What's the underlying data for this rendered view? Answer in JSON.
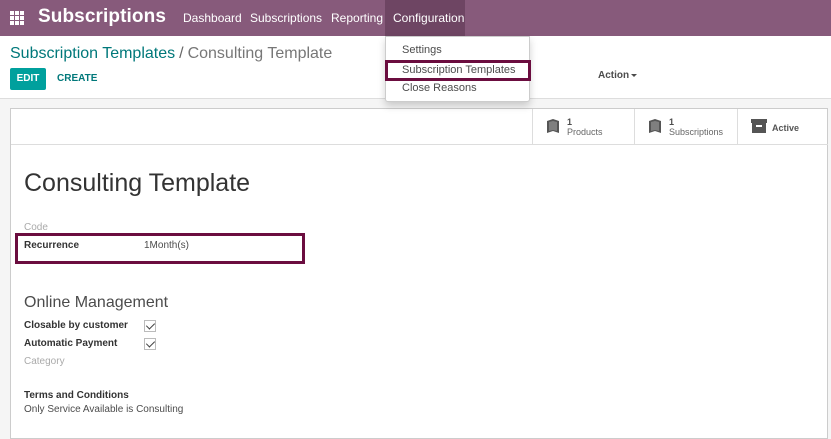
{
  "navbar": {
    "app_name": "Subscriptions",
    "menu": [
      "Dashboard",
      "Subscriptions",
      "Reporting",
      "Configuration"
    ],
    "active": "Configuration",
    "apps_icon": "apps-grid-icon"
  },
  "dropdown": {
    "items": [
      "Settings",
      "Subscription Templates",
      "Close Reasons"
    ],
    "highlighted": "Subscription Templates"
  },
  "breadcrumb": {
    "parent": "Subscription Templates",
    "separator": "/",
    "current": "Consulting Template"
  },
  "buttons": {
    "edit": "EDIT",
    "create": "CREATE",
    "action": "Action"
  },
  "stat_buttons": [
    {
      "icon": "book-icon",
      "value": "1",
      "label": "Products"
    },
    {
      "icon": "book-icon",
      "value": "1",
      "label": "Subscriptions"
    },
    {
      "icon": "archive-icon",
      "value": "",
      "label": "Active"
    }
  ],
  "form": {
    "title": "Consulting Template",
    "code_label": "Code",
    "recurrence_label": "Recurrence",
    "recurrence_value": "1Month(s)",
    "online_section": "Online Management",
    "closable_label": "Closable by customer",
    "closable_checked": true,
    "autopay_label": "Automatic Payment",
    "autopay_checked": true,
    "category_label": "Category",
    "terms_label": "Terms and Conditions",
    "terms_value": "Only Service Available is Consulting"
  },
  "colors": {
    "navbar": "#875a7b",
    "primary": "#00a09d",
    "link": "#00787a",
    "highlight_box": "#6b0d3f"
  }
}
